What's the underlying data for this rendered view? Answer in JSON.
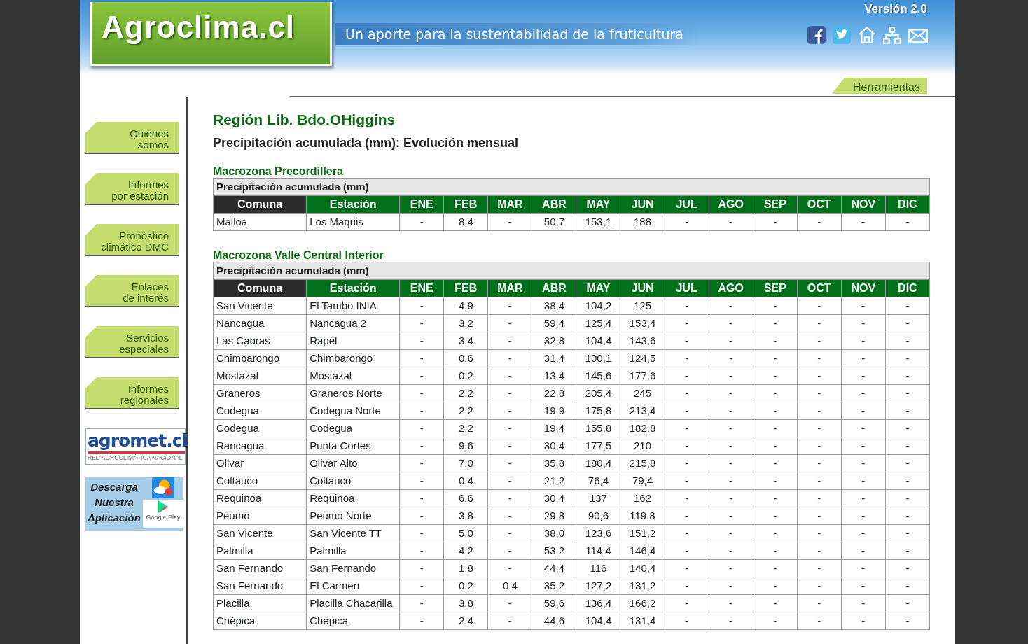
{
  "header": {
    "logo": "Agroclima.cl",
    "slogan": "Un aporte para la sustentabilidad de la fruticultura",
    "version": "Versión 2.0"
  },
  "tools_tab": "Herramientas",
  "sidebar": {
    "items": [
      {
        "lines": [
          "Quienes",
          "somos"
        ]
      },
      {
        "lines": [
          "Informes",
          "por estación"
        ]
      },
      {
        "lines": [
          "Pronóstico",
          "climático DMC"
        ]
      },
      {
        "lines": [
          "Enlaces",
          "de interés"
        ]
      },
      {
        "lines": [
          "Servicios",
          "especiales"
        ]
      },
      {
        "lines": [
          "Informes",
          "regionales"
        ]
      }
    ],
    "agromet_banner": {
      "name": "agromet.cl",
      "tagline": "RED AGROCLIMÁTICA NACIONAL"
    },
    "app_banner": {
      "lines": [
        "Descarga",
        "Nuestra",
        "Aplicación"
      ],
      "store": "Google Play"
    }
  },
  "region_title": "Región Lib. Bdo.OHiggins",
  "subtitle": "Precipitación acumulada (mm): Evolución mensual",
  "sections": [
    {
      "title": "Macrozona Precordillera",
      "caption": "Precipitación acumulada (mm)",
      "columns": [
        "Comuna",
        "Estación",
        "ENE",
        "FEB",
        "MAR",
        "ABR",
        "MAY",
        "JUN",
        "JUL",
        "AGO",
        "SEP",
        "OCT",
        "NOV",
        "DIC"
      ],
      "rows": [
        [
          "Malloa",
          "Los Maquis",
          "-",
          "8,4",
          "-",
          "50,7",
          "153,1",
          "188",
          "-",
          "-",
          "-",
          "-",
          "-",
          "-"
        ]
      ]
    },
    {
      "title": "Macrozona Valle Central Interior",
      "caption": "Precipitación acumulada (mm)",
      "columns": [
        "Comuna",
        "Estación",
        "ENE",
        "FEB",
        "MAR",
        "ABR",
        "MAY",
        "JUN",
        "JUL",
        "AGO",
        "SEP",
        "OCT",
        "NOV",
        "DIC"
      ],
      "rows": [
        [
          "San Vicente",
          "El Tambo INIA",
          "-",
          "4,9",
          "-",
          "38,4",
          "104,2",
          "125",
          "-",
          "-",
          "-",
          "-",
          "-",
          "-"
        ],
        [
          "Nancagua",
          "Nancagua 2",
          "-",
          "3,2",
          "-",
          "59,4",
          "125,4",
          "153,4",
          "-",
          "-",
          "-",
          "-",
          "-",
          "-"
        ],
        [
          "Las Cabras",
          "Rapel",
          "-",
          "3,4",
          "-",
          "32,8",
          "104,4",
          "143,6",
          "-",
          "-",
          "-",
          "-",
          "-",
          "-"
        ],
        [
          "Chimbarongo",
          "Chimbarongo",
          "-",
          "0,6",
          "-",
          "31,4",
          "100,1",
          "124,5",
          "-",
          "-",
          "-",
          "-",
          "-",
          "-"
        ],
        [
          "Mostazal",
          "Mostazal",
          "-",
          "0,2",
          "-",
          "13,4",
          "145,6",
          "177,6",
          "-",
          "-",
          "-",
          "-",
          "-",
          "-"
        ],
        [
          "Graneros",
          "Graneros Norte",
          "-",
          "2,2",
          "-",
          "22,8",
          "205,4",
          "245",
          "-",
          "-",
          "-",
          "-",
          "-",
          "-"
        ],
        [
          "Codegua",
          "Codegua Norte",
          "-",
          "2,2",
          "-",
          "19,9",
          "175,8",
          "213,4",
          "-",
          "-",
          "-",
          "-",
          "-",
          "-"
        ],
        [
          "Codegua",
          "Codegua",
          "-",
          "2,2",
          "-",
          "19,4",
          "155,8",
          "182,8",
          "-",
          "-",
          "-",
          "-",
          "-",
          "-"
        ],
        [
          "Rancagua",
          "Punta Cortes",
          "-",
          "9,6",
          "-",
          "30,4",
          "177,5",
          "210",
          "-",
          "-",
          "-",
          "-",
          "-",
          "-"
        ],
        [
          "Olivar",
          "Olivar Alto",
          "-",
          "7,0",
          "-",
          "35,8",
          "180,4",
          "215,8",
          "-",
          "-",
          "-",
          "-",
          "-",
          "-"
        ],
        [
          "Coltauco",
          "Coltauco",
          "-",
          "0,4",
          "-",
          "21,2",
          "76,4",
          "79,4",
          "-",
          "-",
          "-",
          "-",
          "-",
          "-"
        ],
        [
          "Requinoa",
          "Requinoa",
          "-",
          "6,6",
          "-",
          "30,4",
          "137",
          "162",
          "-",
          "-",
          "-",
          "-",
          "-",
          "-"
        ],
        [
          "Peumo",
          "Peumo Norte",
          "-",
          "3,8",
          "-",
          "29,8",
          "90,6",
          "119,8",
          "-",
          "-",
          "-",
          "-",
          "-",
          "-"
        ],
        [
          "San Vicente",
          "San Vicente TT",
          "-",
          "5,0",
          "-",
          "38,0",
          "123,6",
          "151,2",
          "-",
          "-",
          "-",
          "-",
          "-",
          "-"
        ],
        [
          "Palmilla",
          "Palmilla",
          "-",
          "4,2",
          "-",
          "53,2",
          "114,4",
          "146,4",
          "-",
          "-",
          "-",
          "-",
          "-",
          "-"
        ],
        [
          "San Fernando",
          "San Fernando",
          "-",
          "1,8",
          "-",
          "44,4",
          "116",
          "140,4",
          "-",
          "-",
          "-",
          "-",
          "-",
          "-"
        ],
        [
          "San Fernando",
          "El Carmen",
          "-",
          "0,2",
          "0,4",
          "35,2",
          "127,2",
          "131,2",
          "-",
          "-",
          "-",
          "-",
          "-",
          "-"
        ],
        [
          "Placilla",
          "Placilla Chacarilla",
          "-",
          "3,8",
          "-",
          "59,6",
          "136,4",
          "166,2",
          "-",
          "-",
          "-",
          "-",
          "-",
          "-"
        ],
        [
          "Chépica",
          "Chépica",
          "-",
          "2,4",
          "-",
          "44,6",
          "104,4",
          "131,4",
          "-",
          "-",
          "-",
          "-",
          "-",
          "-"
        ]
      ]
    }
  ]
}
